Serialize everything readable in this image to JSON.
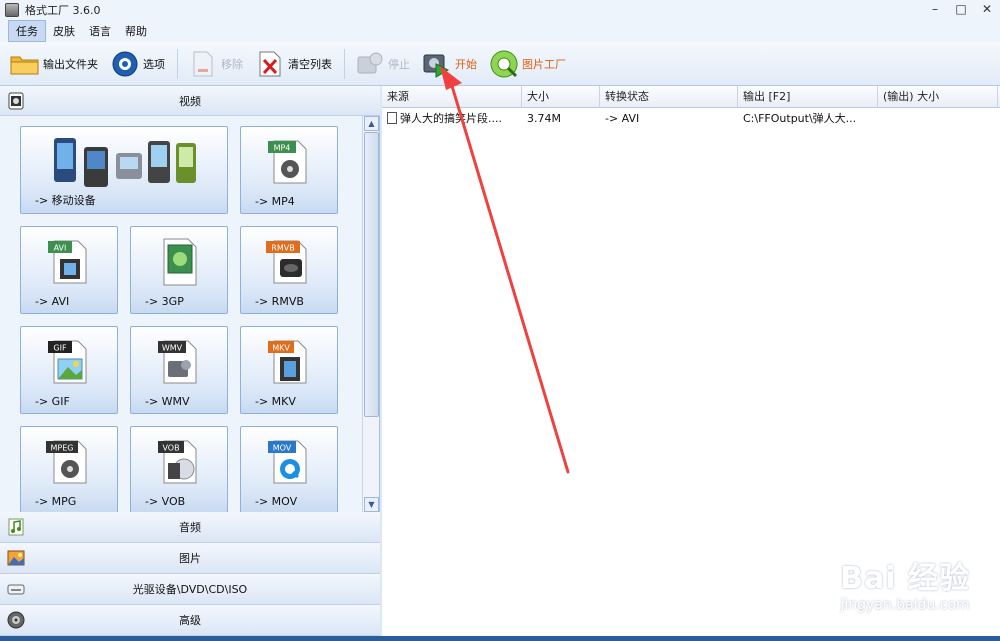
{
  "window": {
    "title": "格式工厂 3.6.0",
    "minimize": "–",
    "maximize": "□",
    "close": "✕"
  },
  "menu": [
    {
      "label": "任务",
      "active": true
    },
    {
      "label": "皮肤"
    },
    {
      "label": "语言"
    },
    {
      "label": "帮助"
    }
  ],
  "toolbar": {
    "output_folder": "输出文件夹",
    "options": "选项",
    "remove": "移除",
    "clear_list": "清空列表",
    "stop": "停止",
    "start": "开始",
    "picture_factory": "图片工厂"
  },
  "categories": {
    "video": "视频",
    "audio": "音频",
    "picture": "图片",
    "disc": "光驱设备\\DVD\\CD\\ISO",
    "advanced": "高级"
  },
  "tiles": [
    {
      "label": "-> 移动设备",
      "badge": "",
      "color": "#3a7fc8"
    },
    {
      "label": "-> MP4",
      "badge": "MP4",
      "color": "#3c8f4e"
    },
    {
      "label": "-> AVI",
      "badge": "AVI",
      "color": "#3c8f4e"
    },
    {
      "label": "-> 3GP",
      "badge": "",
      "color": "#3c8f4e"
    },
    {
      "label": "-> RMVB",
      "badge": "RMVB",
      "color": "#e06d1c"
    },
    {
      "label": "-> GIF",
      "badge": "GIF",
      "color": "#222222"
    },
    {
      "label": "-> WMV",
      "badge": "WMV",
      "color": "#333333"
    },
    {
      "label": "-> MKV",
      "badge": "MKV",
      "color": "#e06d1c"
    },
    {
      "label": "-> MPG",
      "badge": "MPEG",
      "color": "#333333"
    },
    {
      "label": "-> VOB",
      "badge": "VOB",
      "color": "#333333"
    },
    {
      "label": "-> MOV",
      "badge": "MOV",
      "color": "#2a78c8"
    }
  ],
  "table": {
    "columns": [
      "来源",
      "大小",
      "转换状态",
      "输出 [F2]",
      "(输出) 大小"
    ],
    "rows": [
      {
        "source": "弹人大的搞笑片段....",
        "size": "3.74M",
        "status": "-> AVI",
        "output": "C:\\FFOutput\\弹人大...",
        "out_size": ""
      }
    ]
  },
  "watermark": {
    "main": "Bai 经验",
    "sub": "jingyan.baidu.com"
  },
  "colors": {
    "accent": "#2b5d9b",
    "arrow": "#f04040",
    "highlight": "#e06010"
  }
}
